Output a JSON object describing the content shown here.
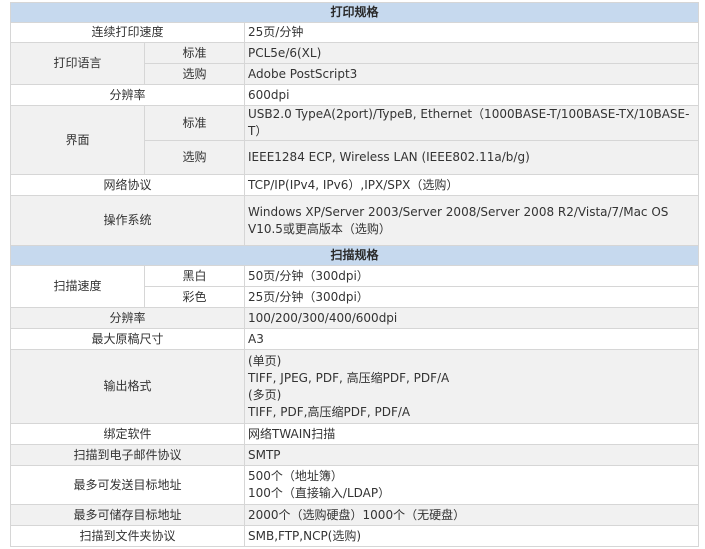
{
  "print_section_title": "打印规格",
  "scan_section_title": "扫描规格",
  "print": {
    "speed": {
      "label": "连续打印速度",
      "value": "25页/分钟"
    },
    "language": {
      "label": "打印语言",
      "standard": {
        "label": "标准",
        "value": "PCL5e/6(XL)"
      },
      "optional": {
        "label": "选购",
        "value": "Adobe PostScript3"
      }
    },
    "resolution": {
      "label": "分辨率",
      "value": "600dpi"
    },
    "interface": {
      "label": "界面",
      "standard": {
        "label": "标准",
        "value": "USB2.0 TypeA(2port)/TypeB, Ethernet（1000BASE-T/100BASE-TX/10BASE-T）"
      },
      "optional": {
        "label": "选购",
        "value": "IEEE1284 ECP, Wireless LAN (IEEE802.11a/b/g)"
      }
    },
    "protocol": {
      "label": "网络协议",
      "value": "TCP/IP(IPv4, IPv6）,IPX/SPX（选购）"
    },
    "os": {
      "label": "操作系统",
      "value": "Windows XP/Server 2003/Server 2008/Server 2008 R2/Vista/7/Mac OS V10.5或更高版本（选购）"
    }
  },
  "scan": {
    "speed": {
      "label": "扫描速度",
      "bw": {
        "label": "黑白",
        "value": "50页/分钟（300dpi）"
      },
      "color": {
        "label": "彩色",
        "value": "25页/分钟（300dpi）"
      }
    },
    "resolution": {
      "label": "分辨率",
      "value": "100/200/300/400/600dpi"
    },
    "max_size": {
      "label": "最大原稿尺寸",
      "value": "A3"
    },
    "output_format": {
      "label": "输出格式",
      "lines": [
        "(单页)",
        "TIFF, JPEG, PDF, 高压缩PDF, PDF/A",
        "(多页)",
        "TIFF, PDF,高压缩PDF, PDF/A"
      ]
    },
    "software": {
      "label": "绑定软件",
      "value": "网络TWAIN扫描"
    },
    "email_protocol": {
      "label": "扫描到电子邮件协议",
      "value": "SMTP"
    },
    "max_dest": {
      "label": "最多可发送目标地址",
      "lines": [
        "500个（地址簿）",
        "100个（直接输入/LDAP）"
      ]
    },
    "max_store": {
      "label": "最多可储存目标地址",
      "value": "2000个（选购硬盘）1000个（无硬盘）"
    },
    "folder_protocol": {
      "label": "扫描到文件夹协议",
      "value": "SMB,FTP,NCP(选购)"
    }
  }
}
